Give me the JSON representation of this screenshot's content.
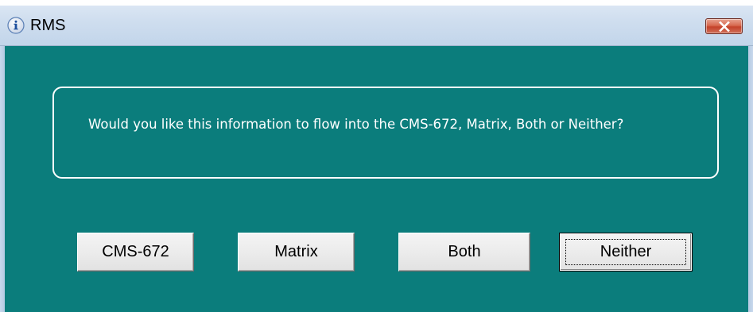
{
  "window": {
    "title": "RMS",
    "title_icon": "info-icon",
    "close_icon": "close-icon"
  },
  "dialog": {
    "message": "Would you like this information to flow into the CMS-672, Matrix, Both or Neither?"
  },
  "buttons": {
    "cms672": "CMS-672",
    "matrix": "Matrix",
    "both": "Both",
    "neither": "Neither"
  },
  "colors": {
    "background": "#0b7d7c",
    "text": "#ffffff",
    "close_button": "#c4422a"
  }
}
